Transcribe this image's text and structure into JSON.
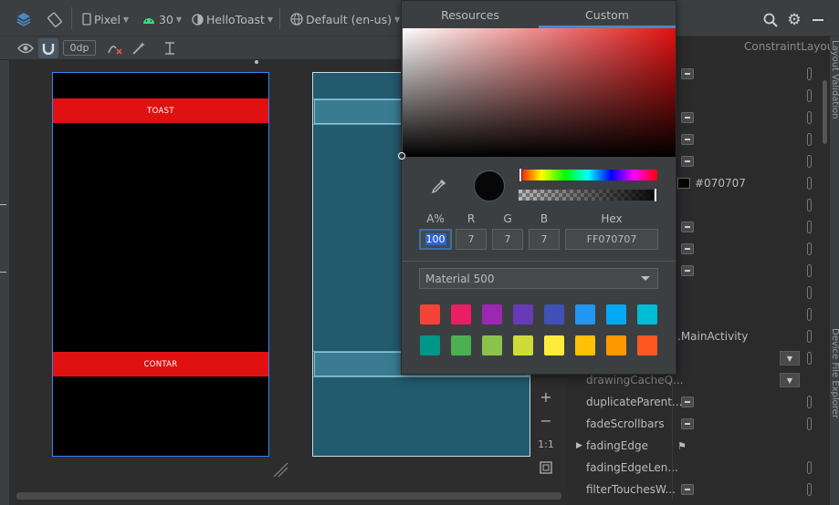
{
  "toolbar": {
    "device": "Pixel",
    "api": "30",
    "app": "HelloToast",
    "locale": "Default (en-us)"
  },
  "secondbar": {
    "margin_value": "0dp"
  },
  "design": {
    "toast_label": "TOAST",
    "count_label": "CONTAR"
  },
  "zoom": {
    "one_to_one": "1:1"
  },
  "picker": {
    "tabs": [
      {
        "label": "Resources",
        "active": false
      },
      {
        "label": "Custom",
        "active": true
      }
    ],
    "hue_fraction": 0.0,
    "alpha_fraction": 1.0,
    "labels": {
      "a": "A%",
      "r": "R",
      "g": "G",
      "b": "B",
      "hex": "Hex"
    },
    "values": {
      "a": "100",
      "r": "7",
      "g": "7",
      "b": "7",
      "hex": "FF070707"
    },
    "current_color": "#070707",
    "palette": "Material 500",
    "swatches": [
      "#f44336",
      "#e91e63",
      "#9c27b0",
      "#673ab7",
      "#3f51b5",
      "#2196f3",
      "#03a9f4",
      "#00bcd4",
      "#009688",
      "#4caf50",
      "#8bc34a",
      "#cddc39",
      "#ffeb3b",
      "#ffc107",
      "#ff9800",
      "#ff5722"
    ]
  },
  "attributes": {
    "layout_label": "ConstraintLayout",
    "background_value": "#070707",
    "context_value": ".MainActivity",
    "rows": [
      {
        "name": "drawingCacheQ...",
        "gray": true
      },
      {
        "name": "duplicateParent...",
        "gray": false
      },
      {
        "name": "fadeScrollbars",
        "gray": false
      },
      {
        "name": "fadingEdge",
        "gray": false
      },
      {
        "name": "fadingEdgeLen...",
        "gray": false
      },
      {
        "name": "filterTouchesW...",
        "gray": false
      }
    ]
  },
  "side_tabs": {
    "layout_validation": "Layout Validation",
    "device_explorer": "Device File Explorer"
  }
}
